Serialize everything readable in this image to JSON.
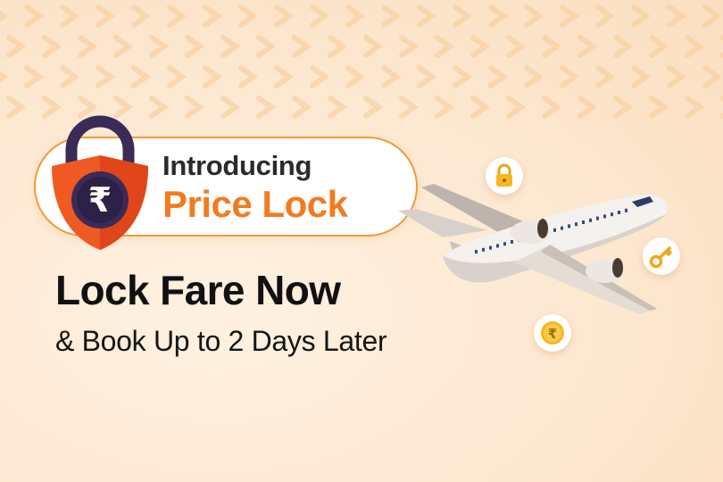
{
  "banner": {
    "intro_label": "Introducing",
    "product_name": "Price Lock",
    "headline": "Lock Fare Now",
    "subheadline": "& Book Up to 2 Days Later",
    "currency_symbol": "₹"
  },
  "icons": {
    "padlock": "padlock-shield-rupee-icon",
    "plane": "airplane-icon",
    "small_lock": "lock-icon",
    "key": "key-icon",
    "coin": "rupee-coin-icon"
  },
  "colors": {
    "accent_orange": "#f47a1f",
    "shield_orange": "#f05a22",
    "padlock_dark": "#3a2b57",
    "background": "#fde9d3"
  }
}
